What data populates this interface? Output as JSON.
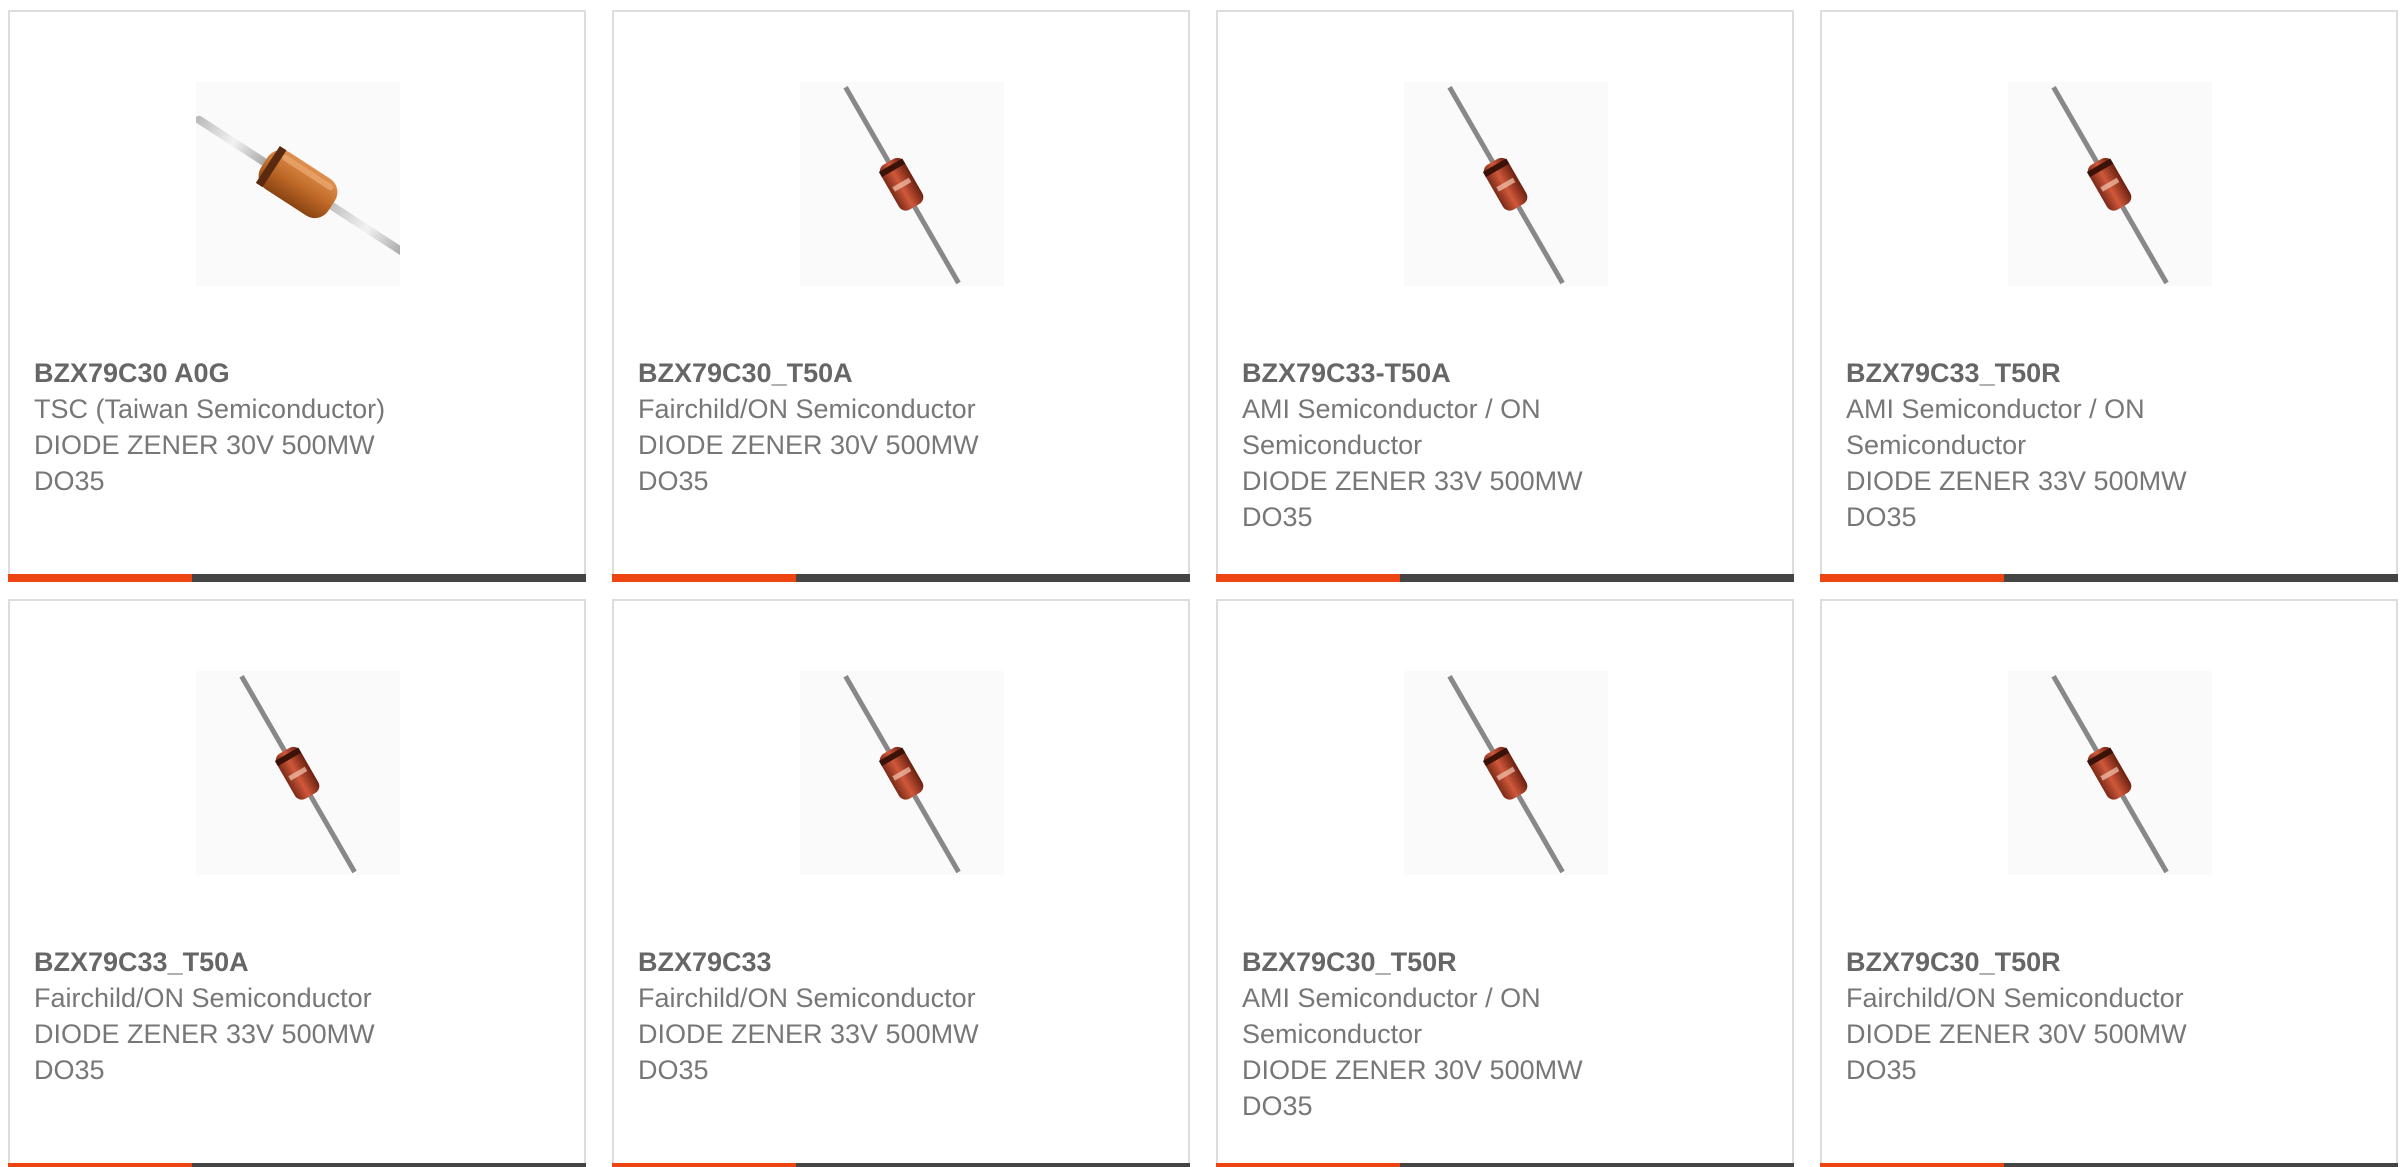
{
  "colors": {
    "accent": "#ee4411",
    "bar": "#444444",
    "border": "#dddddd",
    "text": "#777777"
  },
  "products": [
    {
      "part_number": "BZX79C30 A0G",
      "manufacturer": "TSC (Taiwan Semiconductor)",
      "description": "DIODE ZENER 30V 500MW",
      "package": "DO35",
      "image_icon": "axial-diode-horizontal-icon"
    },
    {
      "part_number": "BZX79C30_T50A",
      "manufacturer": "Fairchild/ON Semiconductor",
      "description": "DIODE ZENER 30V 500MW",
      "package": "DO35",
      "image_icon": "glass-diode-icon"
    },
    {
      "part_number": "BZX79C33-T50A",
      "manufacturer": "AMI Semiconductor / ON Semiconductor",
      "description": "DIODE ZENER 33V 500MW",
      "package": "DO35",
      "image_icon": "glass-diode-icon"
    },
    {
      "part_number": "BZX79C33_T50R",
      "manufacturer": "AMI Semiconductor / ON Semiconductor",
      "description": "DIODE ZENER 33V 500MW",
      "package": "DO35",
      "image_icon": "glass-diode-icon"
    },
    {
      "part_number": "BZX79C33_T50A",
      "manufacturer": "Fairchild/ON Semiconductor",
      "description": "DIODE ZENER 33V 500MW",
      "package": "DO35",
      "image_icon": "glass-diode-icon"
    },
    {
      "part_number": "BZX79C33",
      "manufacturer": "Fairchild/ON Semiconductor",
      "description": "DIODE ZENER 33V 500MW",
      "package": "DO35",
      "image_icon": "glass-diode-icon"
    },
    {
      "part_number": "BZX79C30_T50R",
      "manufacturer": "AMI Semiconductor / ON Semiconductor",
      "description": "DIODE ZENER 30V 500MW",
      "package": "DO35",
      "image_icon": "glass-diode-icon"
    },
    {
      "part_number": "BZX79C30_T50R",
      "manufacturer": "Fairchild/ON Semiconductor",
      "description": "DIODE ZENER 30V 500MW",
      "package": "DO35",
      "image_icon": "glass-diode-icon"
    }
  ]
}
